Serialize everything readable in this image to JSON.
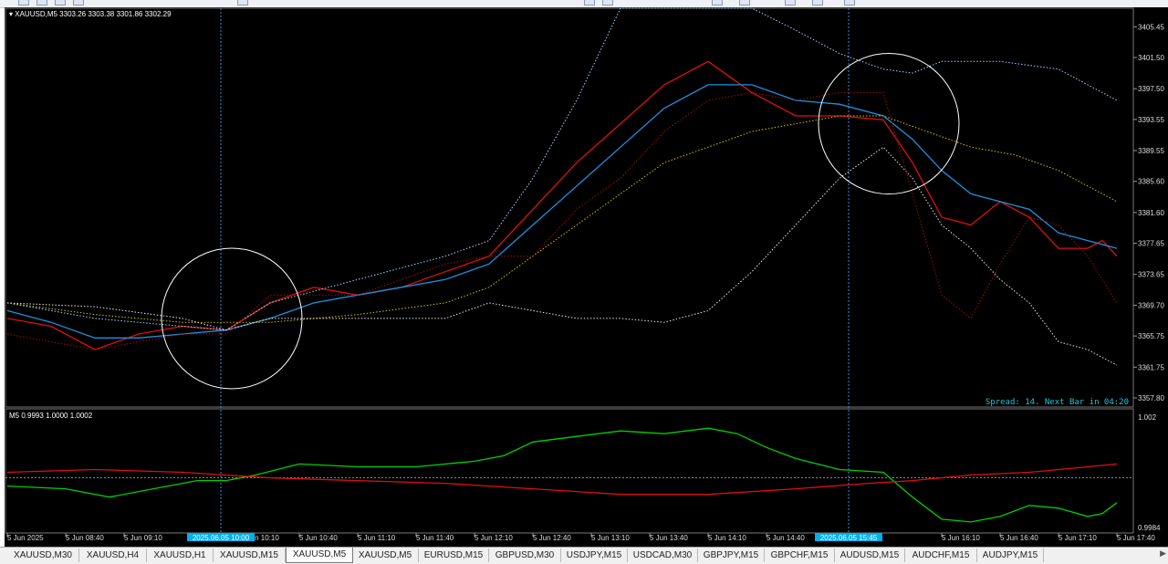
{
  "window": {
    "symbol_info": "XAUUSD,M5",
    "ohlc": "3303.26 3303.38 3301.86 3302.29",
    "spread_text": "Spread: 14. Next Bar in 04:20"
  },
  "colors": {
    "background": "#000000",
    "red_line": "#e01010",
    "blue_line": "#1e90e0",
    "yellow_dotted": "#d4c000",
    "white_dotted": "#e6e6e6",
    "lightblue_dotted": "#9fd3ff",
    "darkred_dotted": "#a01010",
    "osc_green": "#00d000",
    "osc_red": "#e01010",
    "cursor": "#3a8ee6",
    "date_badge": "#00b0f0"
  },
  "chart_data": [
    {
      "type": "line",
      "title": "XAUUSD,M5 3303.26 3303.38 3301.86 3302.29",
      "ylim": [
        3357.8,
        3409.0
      ],
      "y_ticks": [
        "3405.45",
        "3401.50",
        "3397.50",
        "3393.55",
        "3389.55",
        "3385.60",
        "3381.60",
        "3377.65",
        "3373.65",
        "3369.70",
        "3365.75",
        "3361.75",
        "3357.80"
      ],
      "y_tick_values": [
        3405.45,
        3401.5,
        3397.5,
        3393.55,
        3389.55,
        3385.6,
        3381.6,
        3377.65,
        3373.65,
        3369.7,
        3365.75,
        3361.75,
        3357.8
      ],
      "x_ticks": [
        "5 Jun 2025",
        "5 Jun 08:40",
        "5 Jun 09:10",
        "5 Jun 10:10",
        "5 Jun 10:40",
        "5 Jun 11:10",
        "5 Jun 11:40",
        "5 Jun 12:10",
        "5 Jun 12:40",
        "5 Jun 13:10",
        "5 Jun 13:40",
        "5 Jun 14:10",
        "5 Jun 14:40",
        "5 Jun 15:1",
        "5 Jun 16:10",
        "5 Jun 16:40",
        "5 Jun 17:10",
        "5 Jun 17:40"
      ],
      "x_tick_index": [
        0,
        8,
        16,
        32,
        40,
        48,
        56,
        64,
        72,
        80,
        88,
        96,
        104,
        112,
        128,
        136,
        144,
        152
      ],
      "cursor_labels": [
        "2025.06.05 10:00",
        "2025.06.05 15:45"
      ],
      "cursor_index": [
        29,
        115
      ],
      "highlight_circles": [
        {
          "center_index": 30,
          "center_value": 3368.0,
          "radius": 4.5
        },
        {
          "center_index": 120,
          "center_value": 3393.0,
          "radius": 4.5
        }
      ],
      "series": [
        {
          "style": "solid",
          "color": "#e01010",
          "values": [
            [
              0,
              3368
            ],
            [
              6,
              3367
            ],
            [
              12,
              3364
            ],
            [
              18,
              3366
            ],
            [
              24,
              3367
            ],
            [
              30,
              3366.5
            ],
            [
              36,
              3370
            ],
            [
              42,
              3372
            ],
            [
              48,
              3371
            ],
            [
              54,
              3372
            ],
            [
              60,
              3374
            ],
            [
              66,
              3376
            ],
            [
              72,
              3382
            ],
            [
              78,
              3388
            ],
            [
              84,
              3393
            ],
            [
              90,
              3398
            ],
            [
              96,
              3401
            ],
            [
              102,
              3397
            ],
            [
              108,
              3394
            ],
            [
              114,
              3394
            ],
            [
              120,
              3393.5
            ],
            [
              124,
              3388
            ],
            [
              128,
              3381
            ],
            [
              132,
              3380
            ],
            [
              136,
              3383
            ],
            [
              140,
              3381
            ],
            [
              144,
              3377
            ],
            [
              148,
              3377
            ],
            [
              150,
              3378
            ],
            [
              152,
              3376
            ]
          ]
        },
        {
          "style": "solid",
          "color": "#1e90e0",
          "values": [
            [
              0,
              3369
            ],
            [
              6,
              3367.5
            ],
            [
              12,
              3365.5
            ],
            [
              18,
              3365.5
            ],
            [
              24,
              3366
            ],
            [
              30,
              3366.5
            ],
            [
              36,
              3368
            ],
            [
              42,
              3370
            ],
            [
              48,
              3371
            ],
            [
              54,
              3372
            ],
            [
              60,
              3373
            ],
            [
              66,
              3375
            ],
            [
              72,
              3380
            ],
            [
              78,
              3385
            ],
            [
              84,
              3390
            ],
            [
              90,
              3395
            ],
            [
              96,
              3398
            ],
            [
              102,
              3398
            ],
            [
              108,
              3396
            ],
            [
              114,
              3395.5
            ],
            [
              120,
              3394
            ],
            [
              124,
              3391
            ],
            [
              128,
              3387
            ],
            [
              132,
              3384
            ],
            [
              136,
              3383
            ],
            [
              140,
              3382
            ],
            [
              144,
              3379
            ],
            [
              148,
              3378
            ],
            [
              152,
              3377
            ]
          ]
        },
        {
          "style": "dotted",
          "color": "#d4c000",
          "values": [
            [
              0,
              3370
            ],
            [
              12,
              3368.5
            ],
            [
              24,
              3367.5
            ],
            [
              36,
              3367.5
            ],
            [
              48,
              3368.5
            ],
            [
              60,
              3370
            ],
            [
              66,
              3372
            ],
            [
              72,
              3376
            ],
            [
              78,
              3380
            ],
            [
              84,
              3384
            ],
            [
              90,
              3388
            ],
            [
              96,
              3390
            ],
            [
              102,
              3392
            ],
            [
              108,
              3393
            ],
            [
              114,
              3394
            ],
            [
              120,
              3394
            ],
            [
              126,
              3392
            ],
            [
              132,
              3390
            ],
            [
              138,
              3389
            ],
            [
              144,
              3387
            ],
            [
              152,
              3383
            ]
          ]
        },
        {
          "style": "dotted",
          "color": "#9fd3ff",
          "values": [
            [
              0,
              3370
            ],
            [
              12,
              3368
            ],
            [
              24,
              3367
            ],
            [
              30,
              3366.5
            ],
            [
              36,
              3370
            ],
            [
              48,
              3373
            ],
            [
              60,
              3376
            ],
            [
              66,
              3378
            ],
            [
              72,
              3386
            ],
            [
              78,
              3396
            ],
            [
              84,
              3409
            ],
            [
              90,
              3409
            ],
            [
              96,
              3409
            ],
            [
              102,
              3409
            ],
            [
              108,
              3405
            ],
            [
              114,
              3402
            ],
            [
              120,
              3400
            ],
            [
              124,
              3399.5
            ],
            [
              128,
              3401
            ],
            [
              136,
              3401
            ],
            [
              144,
              3400
            ],
            [
              152,
              3396
            ]
          ]
        },
        {
          "style": "dotted",
          "color": "#e6e6e6",
          "values": [
            [
              0,
              3370
            ],
            [
              12,
              3369.5
            ],
            [
              24,
              3368
            ],
            [
              30,
              3366.5
            ],
            [
              36,
              3368
            ],
            [
              48,
              3368
            ],
            [
              60,
              3368
            ],
            [
              66,
              3370
            ],
            [
              72,
              3369
            ],
            [
              78,
              3368
            ],
            [
              84,
              3368
            ],
            [
              90,
              3367.5
            ],
            [
              96,
              3369
            ],
            [
              102,
              3374
            ],
            [
              108,
              3380
            ],
            [
              114,
              3386
            ],
            [
              120,
              3390
            ],
            [
              124,
              3386
            ],
            [
              128,
              3380
            ],
            [
              132,
              3377
            ],
            [
              136,
              3373
            ],
            [
              140,
              3370
            ],
            [
              144,
              3365
            ],
            [
              148,
              3364
            ],
            [
              152,
              3362
            ]
          ]
        },
        {
          "style": "dotted",
          "color": "#a01010",
          "values": [
            [
              0,
              3366
            ],
            [
              12,
              3364
            ],
            [
              24,
              3366
            ],
            [
              30,
              3366
            ],
            [
              36,
              3371
            ],
            [
              48,
              3371
            ],
            [
              60,
              3375
            ],
            [
              66,
              3376
            ],
            [
              72,
              3376
            ],
            [
              78,
              3382
            ],
            [
              84,
              3386
            ],
            [
              90,
              3392
            ],
            [
              96,
              3396
            ],
            [
              102,
              3397
            ],
            [
              108,
              3396
            ],
            [
              114,
              3397
            ],
            [
              120,
              3397
            ],
            [
              124,
              3384
            ],
            [
              128,
              3371
            ],
            [
              132,
              3368
            ],
            [
              136,
              3375
            ],
            [
              140,
              3381
            ],
            [
              144,
              3380
            ],
            [
              148,
              3376
            ],
            [
              152,
              3370
            ]
          ]
        }
      ]
    },
    {
      "type": "line",
      "title": "M5 0.9993 1.0000 1.0002",
      "ylim": [
        0.998,
        1.0025
      ],
      "y_ticks": [
        "1.002",
        "0.9984"
      ],
      "y_tick_values": [
        1.0022,
        0.9982
      ],
      "reference_level": 1.0,
      "series": [
        {
          "style": "solid",
          "color": "#00d000",
          "values": [
            [
              0,
              0.9997
            ],
            [
              8,
              0.9996
            ],
            [
              14,
              0.9993
            ],
            [
              20,
              0.9996
            ],
            [
              26,
              0.9999
            ],
            [
              30,
              0.9999
            ],
            [
              34,
              1.0001
            ],
            [
              40,
              1.0005
            ],
            [
              48,
              1.0004
            ],
            [
              56,
              1.0004
            ],
            [
              64,
              1.0006
            ],
            [
              68,
              1.0008
            ],
            [
              72,
              1.0013
            ],
            [
              78,
              1.0015
            ],
            [
              84,
              1.0017
            ],
            [
              90,
              1.0016
            ],
            [
              96,
              1.0018
            ],
            [
              100,
              1.0016
            ],
            [
              104,
              1.0011
            ],
            [
              108,
              1.0007
            ],
            [
              114,
              1.0003
            ],
            [
              120,
              1.0002
            ],
            [
              124,
              0.9993
            ],
            [
              128,
              0.9985
            ],
            [
              132,
              0.9984
            ],
            [
              136,
              0.9986
            ],
            [
              140,
              0.999
            ],
            [
              144,
              0.9989
            ],
            [
              148,
              0.9986
            ],
            [
              150,
              0.9987
            ],
            [
              152,
              0.9991
            ]
          ]
        },
        {
          "style": "solid",
          "color": "#e01010",
          "values": [
            [
              0,
              1.0002
            ],
            [
              12,
              1.0003
            ],
            [
              24,
              1.0002
            ],
            [
              36,
              1.0
            ],
            [
              48,
              0.9999
            ],
            [
              60,
              0.9998
            ],
            [
              72,
              0.9996
            ],
            [
              84,
              0.9994
            ],
            [
              96,
              0.9994
            ],
            [
              108,
              0.9996
            ],
            [
              118,
              0.9998
            ],
            [
              124,
              0.9999
            ],
            [
              132,
              1.0001
            ],
            [
              140,
              1.0002
            ],
            [
              148,
              1.0004
            ],
            [
              152,
              1.0005
            ]
          ]
        }
      ]
    }
  ],
  "tabs": [
    {
      "label": "XAUUSD,M30",
      "active": false
    },
    {
      "label": "XAUUSD,H4",
      "active": false
    },
    {
      "label": "XAUUSD,H1",
      "active": false
    },
    {
      "label": "XAUUSD,M15",
      "active": false
    },
    {
      "label": "XAUUSD,M5",
      "active": true
    },
    {
      "label": "XAUUSD,M5",
      "active": false
    },
    {
      "label": "EURUSD,M15",
      "active": false
    },
    {
      "label": "GBPUSD,M30",
      "active": false
    },
    {
      "label": "USDJPY,M15",
      "active": false
    },
    {
      "label": "USDCAD,M30",
      "active": false
    },
    {
      "label": "GBPJPY,M15",
      "active": false
    },
    {
      "label": "GBPCHF,M15",
      "active": false
    },
    {
      "label": "AUDUSD,M15",
      "active": false
    },
    {
      "label": "AUDCHF,M15",
      "active": false
    },
    {
      "label": "AUDJPY,M15",
      "active": false
    }
  ],
  "icons": {
    "scroll_right": "arrow-right-icon"
  }
}
